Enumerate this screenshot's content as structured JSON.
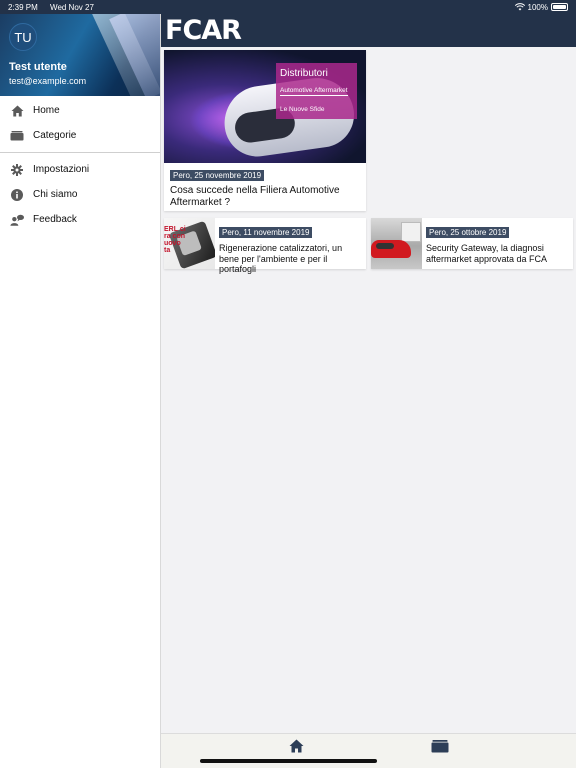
{
  "status_bar": {
    "time": "2:39 PM",
    "date": "Wed Nov 27",
    "battery": "100%"
  },
  "profile": {
    "initials": "TU",
    "name": "Test utente",
    "email": "test@example.com"
  },
  "menu": {
    "primary": [
      {
        "label": "Home",
        "icon": "home-icon"
      },
      {
        "label": "Categorie",
        "icon": "folder-icon"
      }
    ],
    "secondary": [
      {
        "label": "Impostazioni",
        "icon": "gear-icon"
      },
      {
        "label": "Chi siamo",
        "icon": "info-icon"
      },
      {
        "label": "Feedback",
        "icon": "feedback-icon"
      }
    ]
  },
  "header": {
    "logo_text": "FCAR"
  },
  "articles": {
    "featured": {
      "date": "Pero, 25 novembre 2019",
      "title": "Cosa succede nella Filiera Automotive Aftermarket ?",
      "image_text": {
        "line1": "Distributori",
        "line2": "Automotive Aftermarket",
        "line3": "Le Nuove Sfide"
      }
    },
    "items": [
      {
        "date": "Pero, 11 novembre 2019",
        "title": "Rigenerazione catalizzatori, un bene per l'ambiente e per il portafogli",
        "image_text": "ERL ci\nra con\nuovo\nta"
      },
      {
        "date": "Pero, 25 ottobre 2019",
        "title": "Security Gateway, la diagnosi aftermarket approvata da FCA"
      }
    ]
  },
  "tabbar": {
    "tabs": [
      {
        "name": "home",
        "icon": "home-icon"
      },
      {
        "name": "categories",
        "icon": "folder-icon"
      }
    ]
  },
  "colors": {
    "header_bg": "#233249",
    "date_badge_bg": "#3d4c63",
    "icon_gray": "#5a5a5a",
    "tab_icon": "#2d3e57"
  }
}
